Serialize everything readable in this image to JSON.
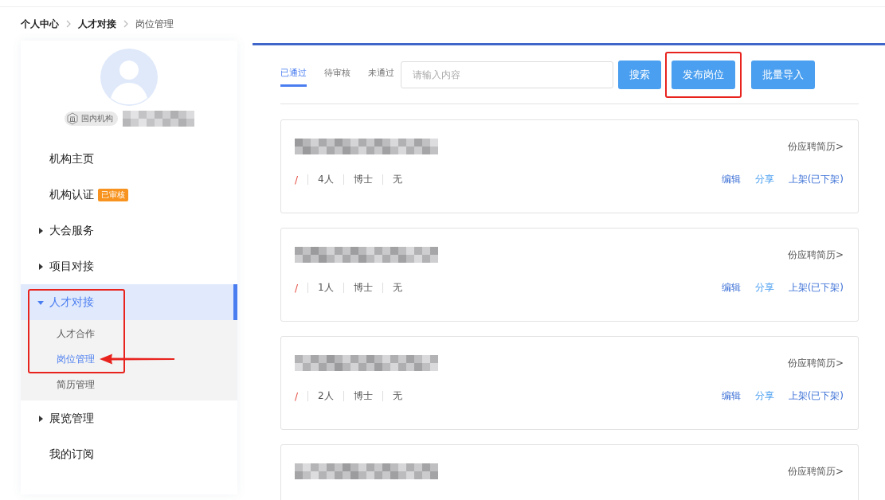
{
  "breadcrumb": [
    {
      "label": "个人中心",
      "current": false
    },
    {
      "label": "人才对接",
      "current": false
    },
    {
      "label": "岗位管理",
      "current": true
    }
  ],
  "profile": {
    "org_type": "国内机构"
  },
  "menu": [
    {
      "label": "机构主页",
      "kind": "link",
      "selected": false
    },
    {
      "label": "机构认证",
      "kind": "link",
      "selected": false,
      "badge": "已审核"
    },
    {
      "label": "大会服务",
      "kind": "group",
      "selected": false,
      "expanded": false,
      "highlighted": false
    },
    {
      "label": "项目对接",
      "kind": "group",
      "selected": false,
      "expanded": false,
      "highlighted": false
    },
    {
      "label": "人才对接",
      "kind": "group",
      "selected": true,
      "expanded": true,
      "highlighted": true,
      "children": [
        {
          "label": "人才合作",
          "selected": false,
          "pointer": false
        },
        {
          "label": "岗位管理",
          "selected": true,
          "pointer": true
        },
        {
          "label": "简历管理",
          "selected": false,
          "pointer": false
        }
      ]
    },
    {
      "label": "展览管理",
      "kind": "group",
      "selected": false,
      "expanded": false,
      "highlighted": false
    },
    {
      "label": "我的订阅",
      "kind": "link",
      "selected": false
    }
  ],
  "tabs": [
    {
      "label": "已通过",
      "selected": true
    },
    {
      "label": "待审核",
      "selected": false
    },
    {
      "label": "未通过",
      "selected": false
    }
  ],
  "search": {
    "placeholder": "请输入内容"
  },
  "buttons": [
    {
      "label": "搜索",
      "highlighted": false
    },
    {
      "label": "发布岗位",
      "highlighted": true
    },
    {
      "label": "批量导入",
      "highlighted": false
    }
  ],
  "jobs": [
    {
      "resume_link": "份应聘简历>",
      "meta": [
        "/",
        "4人",
        "博士",
        "无"
      ],
      "actions": [
        "编辑",
        "分享",
        "上架(已下架)"
      ]
    },
    {
      "resume_link": "份应聘简历>",
      "meta": [
        "/",
        "1人",
        "博士",
        "无"
      ],
      "actions": [
        "编辑",
        "分享",
        "上架(已下架)"
      ]
    },
    {
      "resume_link": "份应聘简历>",
      "meta": [
        "/",
        "2人",
        "博士",
        "无"
      ],
      "actions": [
        "编辑",
        "分享",
        "上架(已下架)"
      ]
    },
    {
      "resume_link": "份应聘简历>"
    }
  ]
}
